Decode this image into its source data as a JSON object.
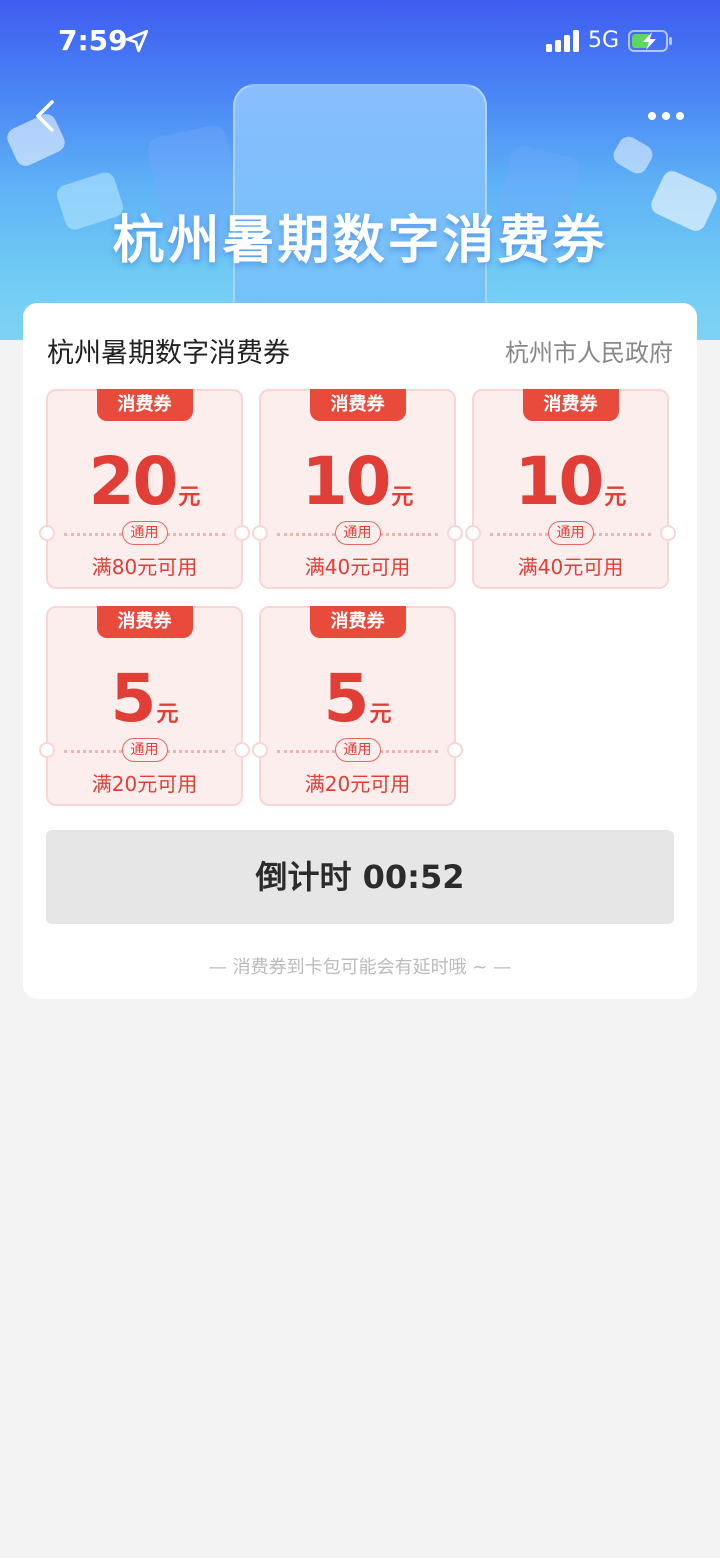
{
  "status_bar": {
    "time": "7:59",
    "network": "5G"
  },
  "banner": {
    "title": "杭州暑期数字消费券"
  },
  "card": {
    "title": "杭州暑期数字消费券",
    "issuer": "杭州市人民政府",
    "coupons": [
      {
        "tag": "消费券",
        "amount": "20",
        "unit": "元",
        "badge": "通用",
        "condition": "满80元可用"
      },
      {
        "tag": "消费券",
        "amount": "10",
        "unit": "元",
        "badge": "通用",
        "condition": "满40元可用"
      },
      {
        "tag": "消费券",
        "amount": "10",
        "unit": "元",
        "badge": "通用",
        "condition": "满40元可用"
      },
      {
        "tag": "消费券",
        "amount": "5",
        "unit": "元",
        "badge": "通用",
        "condition": "满20元可用"
      },
      {
        "tag": "消费券",
        "amount": "5",
        "unit": "元",
        "badge": "通用",
        "condition": "满20元可用"
      }
    ],
    "countdown": "倒计时 00:52",
    "hint": "— 消费券到卡包可能会有延时哦 ~ —"
  },
  "colors": {
    "accent": "#e84a3c",
    "coupon_bg": "#fdeeee",
    "banner_top": "#3f5cf0"
  },
  "icons": {
    "back": "chevron-left-icon",
    "more": "more-dots-icon",
    "location": "location-arrow-icon",
    "signal": "signal-icon",
    "battery": "battery-charging-icon"
  }
}
